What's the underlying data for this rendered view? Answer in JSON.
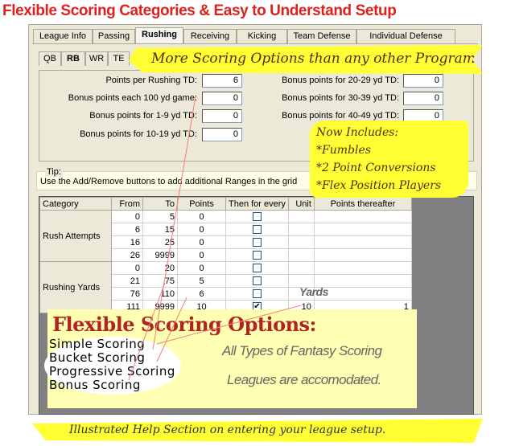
{
  "title": "Flexible Scoring Categories & Easy to Understand Setup",
  "tabs": [
    "League Info",
    "Passing",
    "Rushing",
    "Receiving",
    "Kicking",
    "Team Defense",
    "Individual Defense"
  ],
  "selected_tab": "Rushing",
  "subtabs": [
    "QB",
    "RB",
    "WR",
    "TE"
  ],
  "selected_subtab": "RB",
  "fields_left": [
    {
      "label": "Points per Rushing TD:",
      "value": "6"
    },
    {
      "label": "Bonus points each 100 yd game:",
      "value": "0"
    },
    {
      "label": "Bonus points for 1-9 yd TD:",
      "value": "0"
    },
    {
      "label": "Bonus points for 10-19 yd TD:",
      "value": "0"
    }
  ],
  "fields_right": [
    {
      "label": "Bonus points for 20-29 yd TD:",
      "value": "0"
    },
    {
      "label": "Bonus points for 30-39 yd TD:",
      "value": "0"
    },
    {
      "label": "Bonus points for 40-49 yd TD:",
      "value": "0"
    },
    {
      "label": "Bon",
      "value": ""
    }
  ],
  "tip": {
    "label": "Tip:",
    "text": "Use the Add/Remove buttons to add additional Ranges in the grid"
  },
  "grid": {
    "columns": [
      "Category",
      "From",
      "To",
      "Points",
      "Then for every",
      "Unit",
      "Points thereafter"
    ],
    "groups": [
      {
        "category": "Rush Attempts",
        "rows": [
          [
            "0",
            "5",
            "0",
            false,
            "",
            ""
          ],
          [
            "6",
            "15",
            "0",
            false,
            "",
            ""
          ],
          [
            "16",
            "25",
            "0",
            false,
            "",
            ""
          ],
          [
            "26",
            "9999",
            "0",
            false,
            "",
            ""
          ]
        ]
      },
      {
        "category": "Rushing Yards",
        "rows": [
          [
            "0",
            "20",
            "0",
            false,
            "",
            ""
          ],
          [
            "21",
            "75",
            "5",
            false,
            "",
            ""
          ],
          [
            "76",
            "110",
            "6",
            false,
            "",
            ""
          ],
          [
            "111",
            "9999",
            "10",
            true,
            "10",
            "1"
          ]
        ]
      }
    ]
  },
  "callouts": {
    "more_options": "More Scoring Options than any other Program",
    "now_includes": [
      "Now Includes:",
      "*Fumbles",
      "*2 Point Conversions",
      "*Flex Position Players"
    ],
    "yards": "Yards",
    "flex_title": "Flexible Scoring Options:",
    "flex_options": [
      "Simple Scoring",
      "Bucket Scoring",
      "Progressive Scoring",
      "Bonus Scoring"
    ],
    "all_types": [
      "All Types of Fantasy Scoring",
      "Leagues are accomodated."
    ],
    "help": "Illustrated Help Section on entering your league setup."
  },
  "colors": {
    "title": "#e0201c",
    "highlight": "#ffff33",
    "flex_title": "#b22222"
  }
}
